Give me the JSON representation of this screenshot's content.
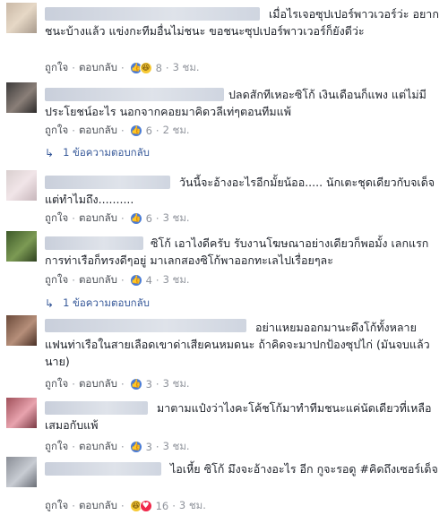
{
  "labels": {
    "like": "ถูกใจ",
    "reply": "ตอบกลับ",
    "dot": "·"
  },
  "comments": [
    {
      "text": "เมื่อไรเจอซุปเปอร์พาวเวอร์ว่ะ อยากชนะบ้างแล้ว แข่งกะทีมอื่นไม่ชนะ ขอชนะซุปเปอร์พาวเวอร์ก็ยังดีว่ะ",
      "reactions": [
        "like",
        "haha"
      ],
      "count": "8",
      "time": "3 ชม."
    },
    {
      "text": "ปลดสักทีเหอะซิโก้ เงินเดือนก็แพง แต่ไม่มีประโยชน์อะไร นอกจากคอยมาคิดวลีเท่ๆตอนทีมแพ้",
      "reactions": [
        "like"
      ],
      "count": "6",
      "time": "2 ชม.",
      "replies": "1 ข้อความตอบกลับ"
    },
    {
      "text": "วันนี้จะอ้างอะไรอีกมั้ยน้ออ..... นักเตะชุดเดียวกับจเด็จ แต่ทำไมถึง..........",
      "reactions": [
        "like"
      ],
      "count": "6",
      "time": "3 ชม."
    },
    {
      "text": "ซิโก้ เอาไงดีครับ รับงานโฆษณาอย่างเดียวก็พอมั้ง เลกแรกการท่าเรือก็ทรงดีๆอยู่ มาเลกสองซิโก้พาออกทะเลไปเรื่อยๆละ",
      "reactions": [
        "like"
      ],
      "count": "4",
      "time": "3 ชม.",
      "replies": "1 ข้อความตอบกลับ"
    },
    {
      "text": "อย่าแหยมออกมานะดึงโก้ทั้งหลาย แฟนท่าเรือในสายเลือดเขาด่าเสียคนหมดนะ ถ้าคิดจะมาปกป้องซุปไก่ (มันจบแล้วนาย)",
      "reactions": [
        "like"
      ],
      "count": "3",
      "time": "3 ชม."
    },
    {
      "text": "มาตามแป๋งว่าไงคะโค้ชโก้มาทำทีมชนะแค่นัดเดียวที่เหลือเสมอกับแพ้",
      "reactions": [
        "like"
      ],
      "count": "3",
      "time": "3 ชม."
    },
    {
      "text": "ไอเหี้ย ซิโก้ มึงจะอ้างอะไร อีก กูจะรอดู #คิดถึงเซอร์เด็จ",
      "reactions": [
        "haha",
        "heart"
      ],
      "count": "16",
      "time": "3 ชม."
    }
  ]
}
